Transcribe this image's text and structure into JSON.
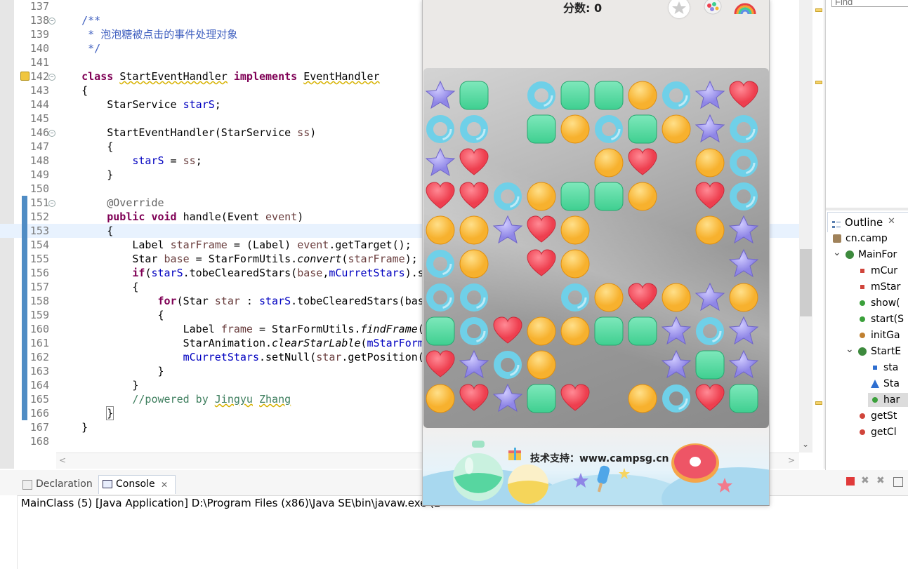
{
  "editor": {
    "lines": [
      {
        "n": "137",
        "html": ""
      },
      {
        "n": "138",
        "html": "    <span class=\"cm\">/**</span>"
      },
      {
        "n": "139",
        "html": "     <span class=\"cm\">* 泡泡糖被点击的事件处理对象</span>"
      },
      {
        "n": "140",
        "html": "     <span class=\"cm\">*/</span>"
      },
      {
        "n": "141",
        "html": ""
      },
      {
        "n": "142",
        "html": "    <span class=\"kw\">class</span> <span class=\"squig\">StartEventHandler</span> <span class=\"kw\">implements</span> <span class=\"squig\">EventHandler</span>"
      },
      {
        "n": "143",
        "html": "    {"
      },
      {
        "n": "144",
        "html": "        StarService <span class=\"fld\">starS</span>;"
      },
      {
        "n": "145",
        "html": ""
      },
      {
        "n": "146",
        "html": "        StartEventHandler(StarService <span style=\"color:#6a3e3e\">ss</span>)"
      },
      {
        "n": "147",
        "html": "        {"
      },
      {
        "n": "148",
        "html": "            <span class=\"fld\">starS</span> = <span style=\"color:#6a3e3e\">ss</span>;"
      },
      {
        "n": "149",
        "html": "        }"
      },
      {
        "n": "150",
        "html": ""
      },
      {
        "n": "151",
        "html": "        <span class=\"ann\">@Override</span>"
      },
      {
        "n": "152",
        "html": "        <span class=\"kw\">public</span> <span class=\"kw\">void</span> handle(Event <span style=\"color:#6a3e3e\">event</span>)"
      },
      {
        "n": "153",
        "html": "        {"
      },
      {
        "n": "154",
        "html": "            Label <span style=\"color:#6a3e3e\">starFrame</span> = (Label) <span style=\"color:#6a3e3e\">event</span>.getTarget();"
      },
      {
        "n": "155",
        "html": "            Star <span style=\"color:#6a3e3e\">base</span> = StarFormUtils.<span class=\"it\">convert</span>(<span style=\"color:#6a3e3e\">starFrame</span>);"
      },
      {
        "n": "156",
        "html": "            <span class=\"kw\">if</span>(<span class=\"fld\">starS</span>.tobeClearedStars(<span style=\"color:#6a3e3e\">base</span>,<span class=\"fld\">mCurretStars</span>).s"
      },
      {
        "n": "157",
        "html": "            {"
      },
      {
        "n": "158",
        "html": "                <span class=\"kw\">for</span>(Star <span style=\"color:#6a3e3e\">star</span> : <span class=\"fld\">starS</span>.tobeClearedStars(bas"
      },
      {
        "n": "159",
        "html": "                {"
      },
      {
        "n": "160",
        "html": "                    Label <span style=\"color:#6a3e3e\">frame</span> = StarFormUtils.<span class=\"it\">findFrame</span>("
      },
      {
        "n": "161",
        "html": "                    StarAnimation.<span class=\"it\">clearStarLable</span>(<span class=\"fld\">mStarForm</span>"
      },
      {
        "n": "162",
        "html": "                    <span class=\"fld\">mCurretStars</span>.setNull(<span style=\"color:#6a3e3e\">star</span>.getPosition("
      },
      {
        "n": "163",
        "html": "                }"
      },
      {
        "n": "164",
        "html": "            }"
      },
      {
        "n": "165",
        "html": "            <span class=\"cm2\">//powered by <span class=\"squig\">Jingyu</span> <span class=\"squig\">Zhang</span></span>"
      },
      {
        "n": "166",
        "html": "        <span class=\"bracket\">}</span>"
      },
      {
        "n": "167",
        "html": "    }"
      },
      {
        "n": "168",
        "html": ""
      }
    ]
  },
  "find": {
    "placeholder": "Find"
  },
  "outline": {
    "tab_label": "Outline",
    "items": [
      {
        "label": "cn.camp",
        "indent": 0,
        "icon": "package-icon",
        "color": "#a0825a"
      },
      {
        "label": "MainFor",
        "indent": 1,
        "icon": "class-icon",
        "color": "#3d8a3d"
      },
      {
        "label": "mCur",
        "indent": 2,
        "icon": "private-field-icon",
        "color": "#d0453b"
      },
      {
        "label": "mStar",
        "indent": 2,
        "icon": "private-field-icon",
        "color": "#d0453b"
      },
      {
        "label": "show(",
        "indent": 2,
        "icon": "public-method-icon",
        "color": "#3ba03b"
      },
      {
        "label": "start(S",
        "indent": 2,
        "icon": "public-method-icon",
        "color": "#3ba03b"
      },
      {
        "label": "initGa",
        "indent": 2,
        "icon": "private-method-icon",
        "color": "#c08030"
      },
      {
        "label": "StartE",
        "indent": 2,
        "icon": "inner-class-icon",
        "color": "#3d8a3d"
      },
      {
        "label": "sta",
        "indent": 3,
        "icon": "default-field-icon",
        "color": "#2f6fd0"
      },
      {
        "label": "Sta",
        "indent": 3,
        "icon": "constructor-icon",
        "color": "#2f6fd0"
      },
      {
        "label": "har",
        "indent": 3,
        "icon": "public-method-icon",
        "color": "#3ba03b"
      },
      {
        "label": "getSt",
        "indent": 2,
        "icon": "private-method-icon",
        "color": "#d0453b"
      },
      {
        "label": "getCl",
        "indent": 2,
        "icon": "private-method-icon",
        "color": "#d0453b"
      }
    ]
  },
  "bottom": {
    "declaration_label": "Declaration",
    "console_label": "Console",
    "console_text": "MainClass (5) [Java Application] D:\\Program Files (x86)\\Java SE\\bin\\javaw.exe (2"
  },
  "game": {
    "score_label": "分数:",
    "score_value": "0",
    "support_text": "技术支持：www.campsg.cn",
    "board": [
      [
        "star",
        "green",
        "",
        "ring",
        "green",
        "green",
        "orange",
        "ring",
        "star",
        "heart"
      ],
      [
        "ring",
        "ring",
        "",
        "green",
        "orange",
        "ring",
        "green",
        "orange",
        "star",
        "ring"
      ],
      [
        "star",
        "heart",
        "",
        "",
        "",
        "orange",
        "heart",
        "",
        "orange",
        "ring"
      ],
      [
        "heart",
        "heart",
        "ring",
        "orange",
        "green",
        "green",
        "orange",
        "",
        "heart",
        "ring"
      ],
      [
        "orange",
        "orange",
        "star",
        "heart",
        "orange",
        "",
        "",
        "",
        "orange",
        "star"
      ],
      [
        "ring",
        "orange",
        "",
        "heart",
        "orange",
        "",
        "",
        "",
        "",
        "star"
      ],
      [
        "ring",
        "ring",
        "",
        "",
        "ring",
        "orange",
        "heart",
        "orange",
        "star",
        "orange"
      ],
      [
        "green",
        "ring",
        "heart",
        "orange",
        "orange",
        "green",
        "green",
        "star",
        "ring",
        "star"
      ],
      [
        "heart",
        "star",
        "ring",
        "orange",
        "",
        "",
        "",
        "star",
        "green",
        "star"
      ],
      [
        "orange",
        "heart",
        "star",
        "green",
        "heart",
        "",
        "orange",
        "ring",
        "heart",
        "green"
      ]
    ],
    "colors": {
      "star": "#8f86e6",
      "green": "#3fcf90",
      "ring": "#6fd0e8",
      "orange": "#f7b12e",
      "heart": "#ee3f4f"
    }
  }
}
